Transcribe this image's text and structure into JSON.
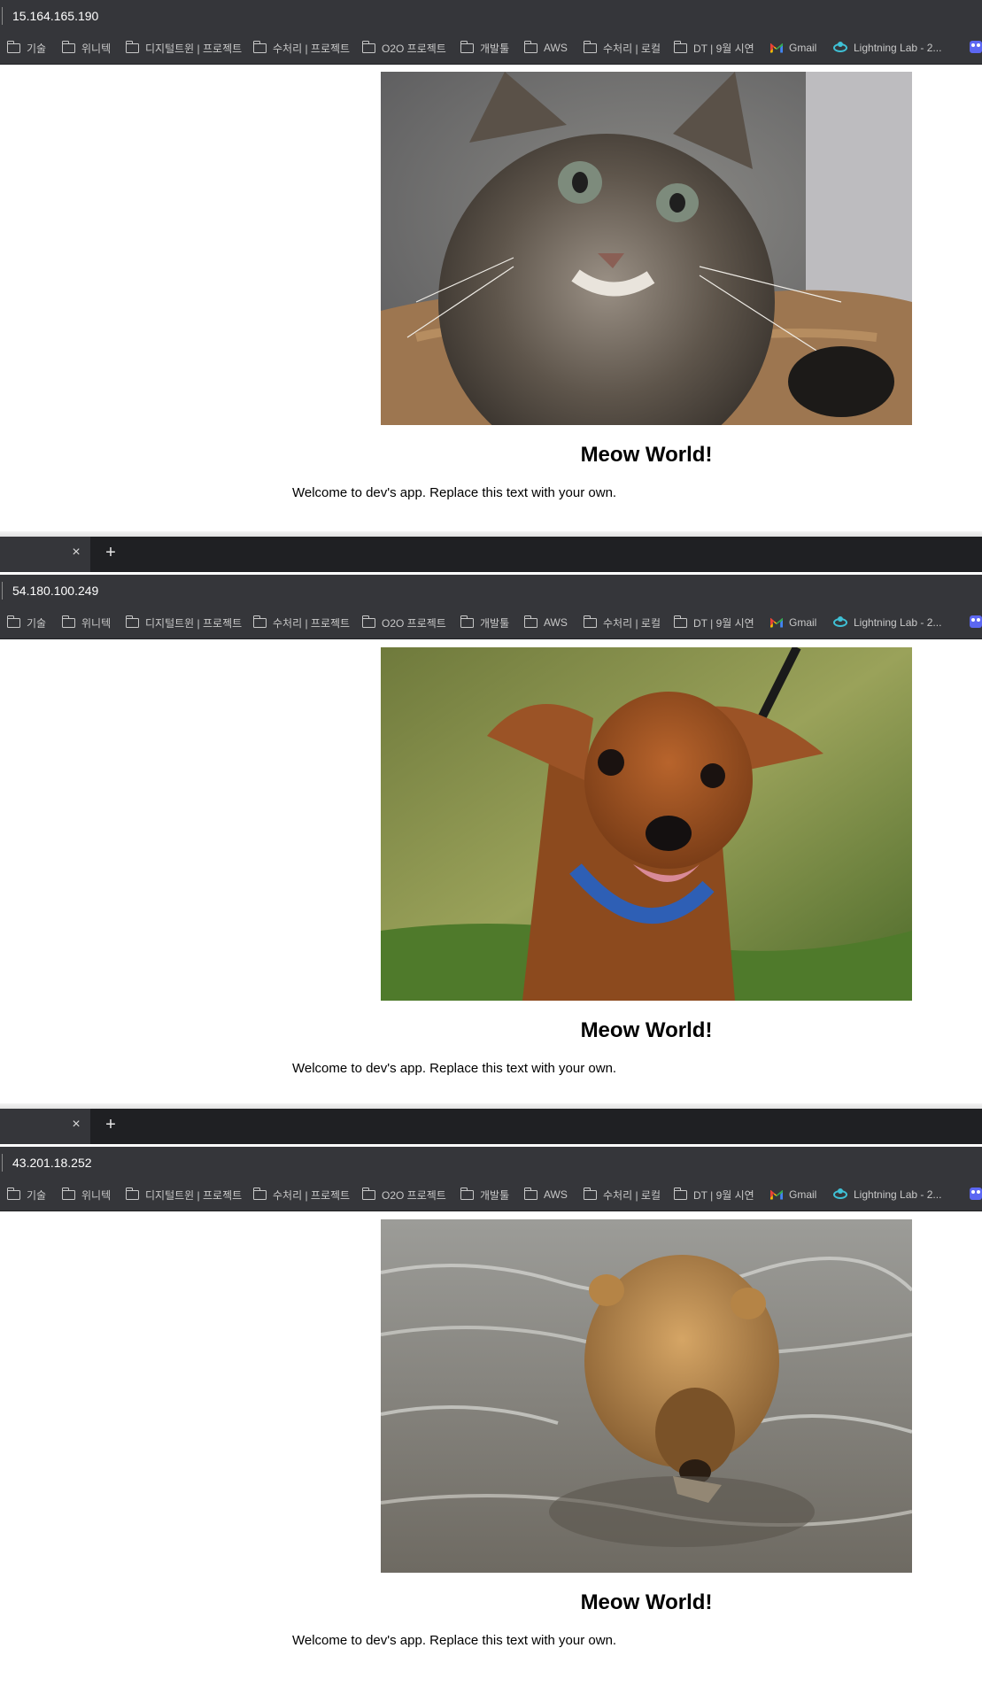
{
  "bookmarks": [
    {
      "label": "기술",
      "icon": "folder-icon"
    },
    {
      "label": "위니텍",
      "icon": "folder-icon"
    },
    {
      "label": "디지털트윈 | 프로젝트",
      "icon": "folder-icon"
    },
    {
      "label": "수처리 | 프로젝트",
      "icon": "folder-icon"
    },
    {
      "label": "O2O 프로젝트",
      "icon": "folder-icon"
    },
    {
      "label": "개발툴",
      "icon": "folder-icon"
    },
    {
      "label": "AWS",
      "icon": "folder-icon"
    },
    {
      "label": "수처리 | 로컬",
      "icon": "folder-icon"
    },
    {
      "label": "DT | 9월 시연",
      "icon": "folder-icon"
    },
    {
      "label": "Gmail",
      "icon": "gmail-icon"
    },
    {
      "label": "Lightning Lab - 2...",
      "icon": "lightning-icon"
    }
  ],
  "windows": [
    {
      "url": "15.164.165.190",
      "image": "kitten-photo",
      "heading": "Meow World!",
      "paragraph": "Welcome to dev's app. Replace this text with your own."
    },
    {
      "url": "54.180.100.249",
      "image": "dog-photo",
      "heading": "Meow World!",
      "paragraph": "Welcome to dev's app. Replace this text with your own.",
      "tab_close": "×",
      "new_tab": "+"
    },
    {
      "url": "43.201.18.252",
      "image": "bear-photo",
      "heading": "Meow World!",
      "paragraph": "Welcome to dev's app. Replace this text with your own.",
      "tab_close": "×",
      "new_tab": "+"
    }
  ]
}
